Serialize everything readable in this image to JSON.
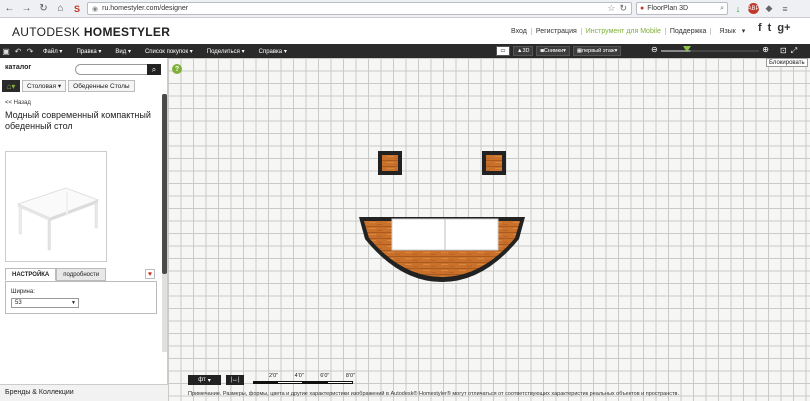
{
  "browser": {
    "url": "ru.homestyler.com/designer",
    "search_text": "FloorPlan 3D",
    "tooltip": "Блокировать"
  },
  "header": {
    "logo_light": "AUTODESK",
    "logo_bold": "HOMESTYLER",
    "links": [
      "Вход",
      "Регистрация",
      "Инструмент для Mobile",
      "Поддержка",
      "Язык"
    ],
    "social": [
      "f",
      "t",
      "g+"
    ]
  },
  "menu": {
    "items": [
      "Файл",
      "Правка",
      "Вид",
      "Список покупок",
      "Поделиться",
      "Справка"
    ],
    "view_3d": "3D",
    "snapshots": "Снимки",
    "floor": "первый этаж"
  },
  "sidebar": {
    "catalog_label": "каталог",
    "crumbs": [
      "Столовая",
      "Обеденные Столы"
    ],
    "back": "<< Назад",
    "product_title": "Модный современный компактный обеденный стол",
    "tabs": [
      "НАСТРОЙКА",
      "подробности"
    ],
    "width_label": "Ширина:",
    "width_value": "53",
    "brands": "Бренды & Коллекции"
  },
  "canvas": {
    "unit": "фт",
    "scale_labels": [
      "2'0\"",
      "4'0\"",
      "6'0\"",
      "8'0\""
    ],
    "note": "Примечание. Размеры, формы, цвета и другие характеристики изображений в Autodesk® Homestyler® могут отличаться от соответствующих характеристик реальных объектов и пространств."
  },
  "colors": {
    "accent": "#7fb13a",
    "menu_bg": "#2a2a2a",
    "wood": "#c9712b"
  }
}
